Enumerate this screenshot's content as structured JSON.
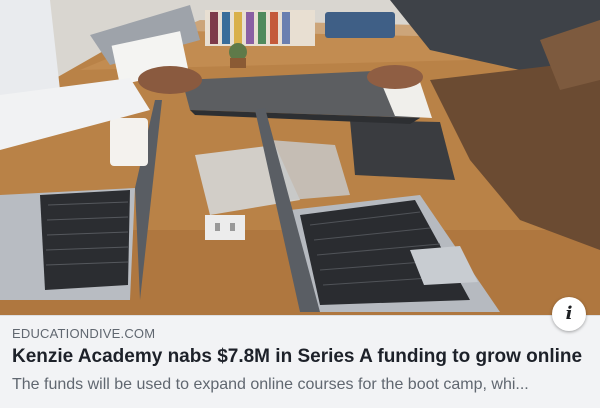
{
  "link_preview": {
    "image_alt_icon": "office-desk-photo",
    "info_icon": "info-icon",
    "info_glyph": "i",
    "domain": "EDUCATIONDIVE.COM",
    "headline": "Kenzie Academy nabs $7.8M in Series A funding to grow online",
    "description": "The funds will be used to expand online courses for the boot camp, whi..."
  },
  "colors": {
    "domain_text": "#606770",
    "headline_text": "#1d2129",
    "meta_background": "#f2f3f5"
  }
}
